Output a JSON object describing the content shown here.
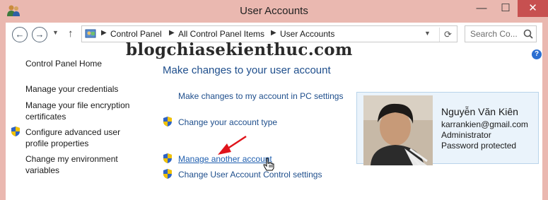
{
  "window": {
    "title": "User Accounts",
    "minimize": "—",
    "maximize": "☐",
    "close": "✕"
  },
  "nav": {
    "back": "←",
    "forward": "→",
    "up": "↑",
    "breadcrumbs": [
      "Control Panel",
      "All Control Panel Items",
      "User Accounts"
    ],
    "search_placeholder": "Search Co..."
  },
  "watermark": "blogchiasekienthuc.com",
  "help": "?",
  "sidebar": {
    "home": "Control Panel Home",
    "items": [
      {
        "label": "Manage your credentials",
        "icon": null
      },
      {
        "label": "Manage your file encryption certificates",
        "icon": null
      },
      {
        "label": "Configure advanced user profile properties",
        "icon": "shield-icon"
      },
      {
        "label": "Change my environment variables",
        "icon": null
      }
    ]
  },
  "main": {
    "heading": "Make changes to your user account",
    "tasks": [
      {
        "label": "Make changes to my account in PC settings",
        "icon": null
      },
      {
        "label": "Change your account type",
        "icon": "shield-icon"
      },
      {
        "label": "Manage another account",
        "icon": "shield-icon"
      },
      {
        "label": "Change User Account Control settings",
        "icon": "shield-icon"
      }
    ]
  },
  "account": {
    "name": "Nguyễn Văn Kiên",
    "email": "karrankien@gmail.com",
    "role": "Administrator",
    "status": "Password protected"
  },
  "colors": {
    "link": "#1e4e8c",
    "titlebar": "#eab8b0",
    "close": "#c75050",
    "arrow": "#e0141b"
  }
}
